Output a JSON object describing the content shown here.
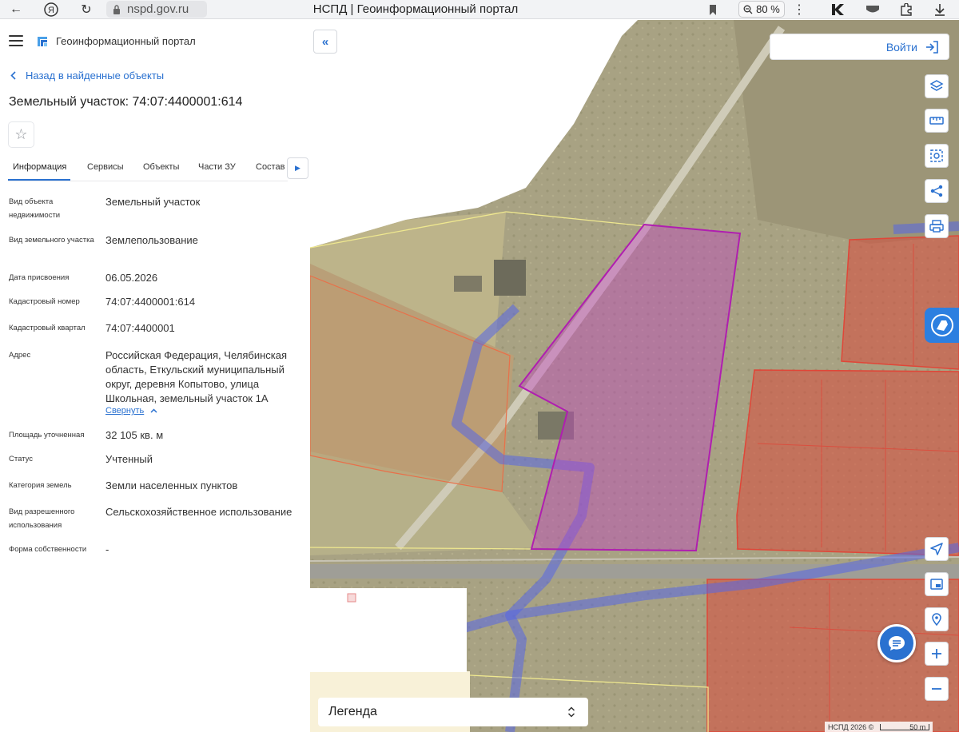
{
  "browser": {
    "url": "nspd.gov.ru",
    "title": "НСПД | Геоинформационный портал",
    "zoom": "80 %"
  },
  "header": {
    "portal_title": "Геоинформационный портал"
  },
  "back_link": "Назад в найденные объекты",
  "object_title": "Земельный участок: 74:07:4400001:614",
  "tabs": [
    {
      "label": "Информация",
      "active": true
    },
    {
      "label": "Сервисы"
    },
    {
      "label": "Объекты"
    },
    {
      "label": "Части ЗУ"
    },
    {
      "label": "Состав"
    }
  ],
  "info": [
    {
      "label": "Вид объекта недвижимости",
      "value": "Земельный участок"
    },
    {
      "label": "Вид земельного участка",
      "value": "Землепользование"
    },
    {
      "label": "Дата присвоения",
      "value": "06.05.2026"
    },
    {
      "label": "Кадастровый номер",
      "value": "74:07:4400001:614"
    },
    {
      "label": "Кадастровый квартал",
      "value": "74:07:4400001"
    },
    {
      "label": "Адрес",
      "value": "Российская Федерация, Челябинская область, Еткульский муниципальный округ, деревня Копытово, улица Школьная, земельный участок 1А"
    },
    {
      "label": "Площадь уточненная",
      "value": "32 105 кв. м"
    },
    {
      "label": "Статус",
      "value": "Учтенный"
    },
    {
      "label": "Категория земель",
      "value": "Земли населенных пунктов"
    },
    {
      "label": "Вид разрешенного использования",
      "value": "Сельскохозяйственное использование"
    },
    {
      "label": "Форма собственности",
      "value": "-"
    }
  ],
  "collapse_label": "Свернуть",
  "map": {
    "login_label": "Войти",
    "legend_label": "Легенда",
    "attribution": "НСПД 2026 ©",
    "scale_label": "50 m",
    "tools": [
      "layers-icon",
      "ruler-icon",
      "select-area-icon",
      "share-icon",
      "print-icon"
    ],
    "bottom_tools": [
      "location-arrow-icon",
      "picture-in-picture-icon",
      "geo-search-icon",
      "zoom-in-icon",
      "zoom-out-icon"
    ],
    "colors": {
      "selected_parcel": "#c040c0",
      "red_parcels": "#d83a3a",
      "blue_lines": "#5a6de8",
      "accent": "#2a71d0"
    }
  }
}
